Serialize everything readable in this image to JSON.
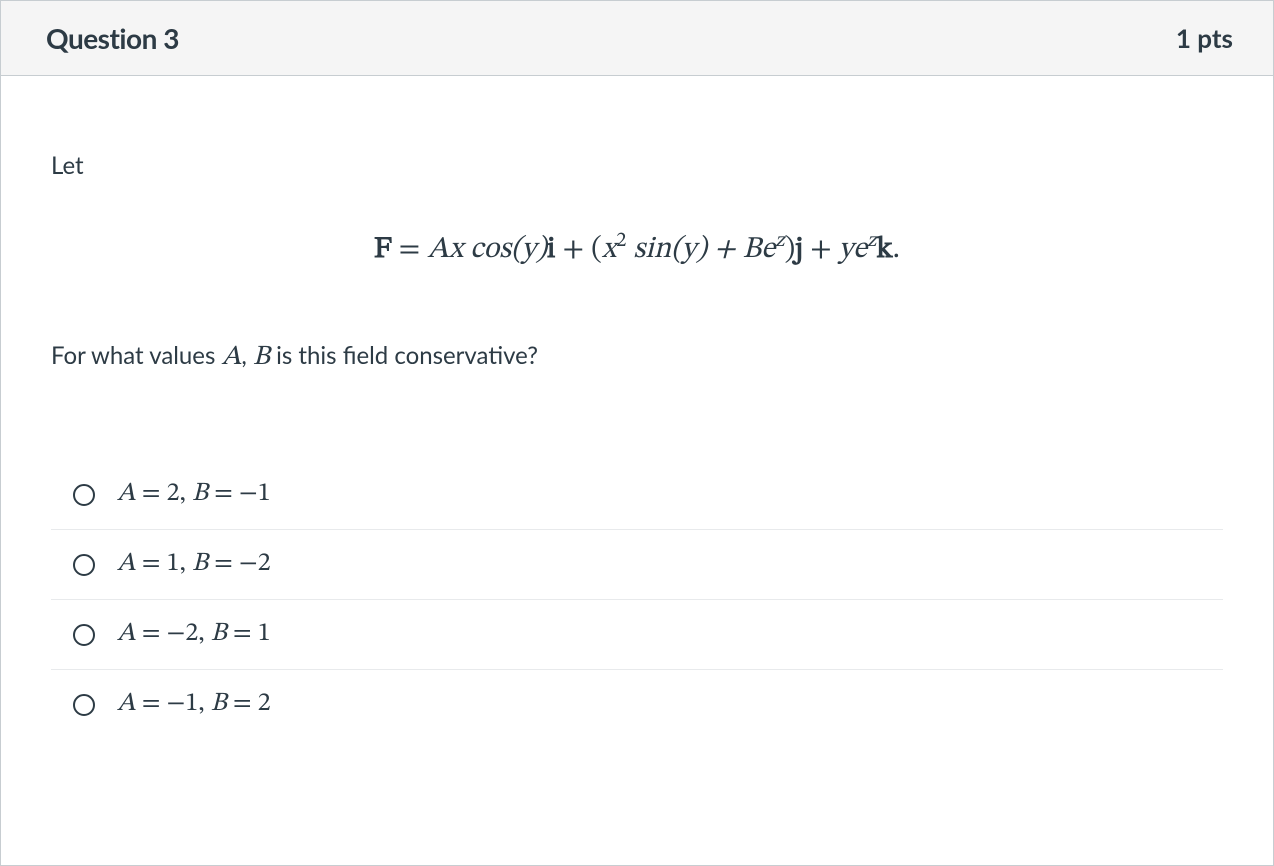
{
  "header": {
    "title": "Question 3",
    "points": "1 pts"
  },
  "prompt": {
    "intro": "Let",
    "equation": {
      "lhs_F": "F",
      "eq": " = ",
      "A": "A",
      "xcosy": "x cos(y)",
      "i": "i",
      "plus1": " + (",
      "x": "x",
      "sup2": "2",
      "siny_plus": " sin(y) + ",
      "B": "B",
      "e1": "e",
      "z1": "z",
      "close_paren": ")",
      "j": "j",
      "plus2": " + ",
      "ye": "ye",
      "z2": "z",
      "k": "k",
      "period": "."
    },
    "follow_pre": "For what values ",
    "follow_A": "A",
    "follow_comma": ", ",
    "follow_B": "B",
    "follow_post": " is this field conservative?"
  },
  "answers": [
    {
      "A_label": "A",
      "A_val": " = 2, ",
      "B_label": "B",
      "B_val": " = −1"
    },
    {
      "A_label": "A",
      "A_val": " = 1, ",
      "B_label": "B",
      "B_val": " = −2"
    },
    {
      "A_label": "A",
      "A_val": " = −2, ",
      "B_label": "B",
      "B_val": " = 1"
    },
    {
      "A_label": "A",
      "A_val": " = −1, ",
      "B_label": "B",
      "B_val": " = 2"
    }
  ]
}
